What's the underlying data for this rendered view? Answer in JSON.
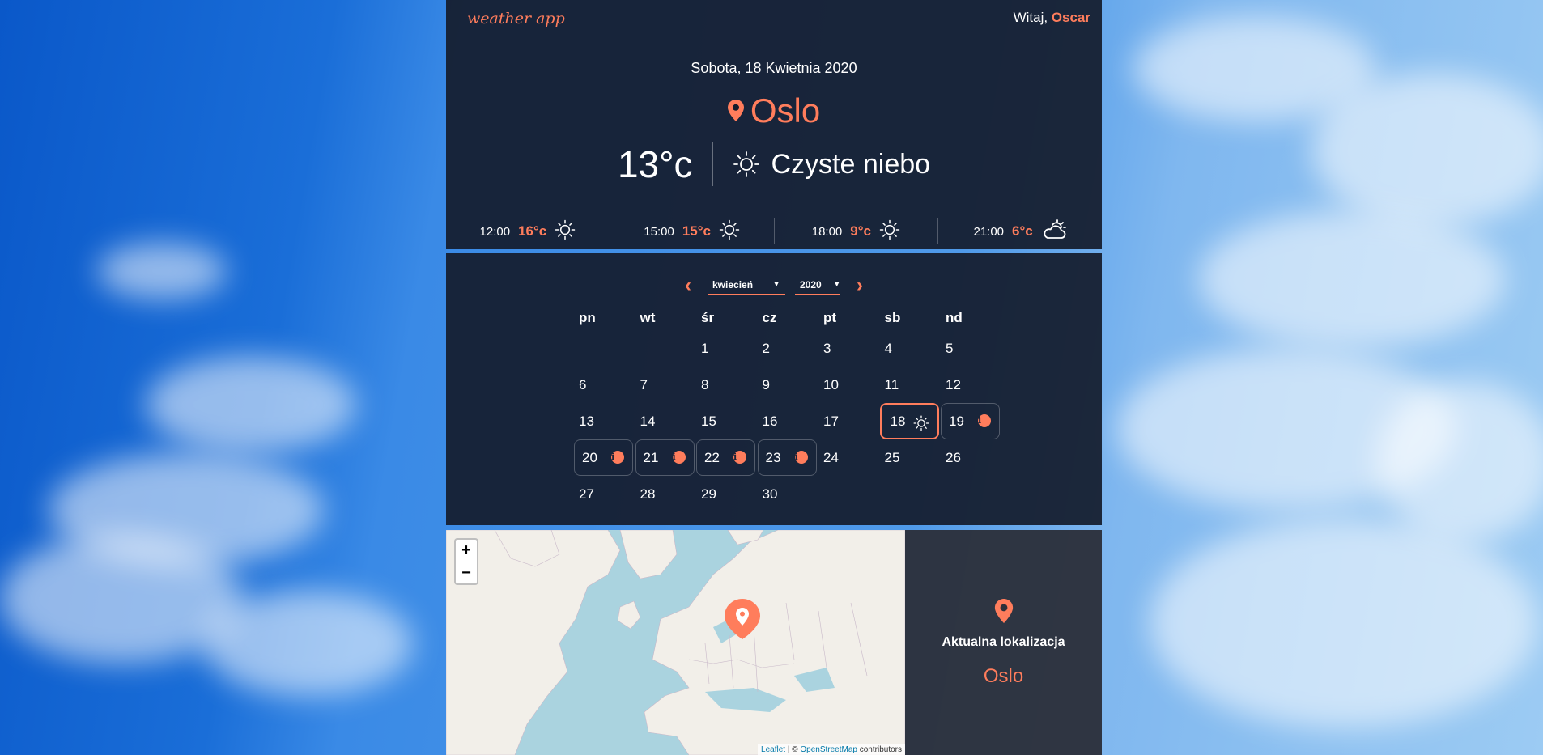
{
  "header": {
    "logo": "weather app",
    "greeting_prefix": "Witaj, ",
    "user_name": "Oscar"
  },
  "current": {
    "date": "Sobota, 18 Kwietnia 2020",
    "city": "Oslo",
    "temperature": "13°c",
    "condition": "Czyste niebo",
    "condition_icon": "sun-icon"
  },
  "hourly": [
    {
      "time": "12:00",
      "temp": "16°c",
      "icon": "sun-icon"
    },
    {
      "time": "15:00",
      "temp": "15°c",
      "icon": "sun-icon"
    },
    {
      "time": "18:00",
      "temp": "9°c",
      "icon": "sun-icon"
    },
    {
      "time": "21:00",
      "temp": "6°c",
      "icon": "cloud-sun-icon"
    }
  ],
  "calendar": {
    "month": "kwiecień",
    "year": "2020",
    "weekdays": [
      "pn",
      "wt",
      "śr",
      "cz",
      "pt",
      "sb",
      "nd"
    ],
    "weeks": [
      [
        "",
        "",
        "1",
        "2",
        "3",
        "4",
        "5"
      ],
      [
        "6",
        "7",
        "8",
        "9",
        "10",
        "11",
        "12"
      ],
      [
        "13",
        "14",
        "15",
        "16",
        "17",
        "18",
        "19"
      ],
      [
        "20",
        "21",
        "22",
        "23",
        "24",
        "25",
        "26"
      ],
      [
        "27",
        "28",
        "29",
        "30",
        "",
        "",
        ""
      ]
    ],
    "selected_day": "18",
    "forecast_days": [
      "19",
      "20",
      "21",
      "22",
      "23"
    ]
  },
  "map": {
    "zoom_in": "+",
    "zoom_out": "−",
    "attribution_leaflet": "Leaflet",
    "attribution_sep": " | © ",
    "attribution_osm": "OpenStreetMap",
    "attribution_suffix": " contributors"
  },
  "location": {
    "title": "Aktualna lokalizacja",
    "city": "Oslo"
  },
  "colors": {
    "accent": "#ff7d5c",
    "panel": "#141c2c",
    "water": "#aad3df",
    "land": "#f2efe9"
  }
}
